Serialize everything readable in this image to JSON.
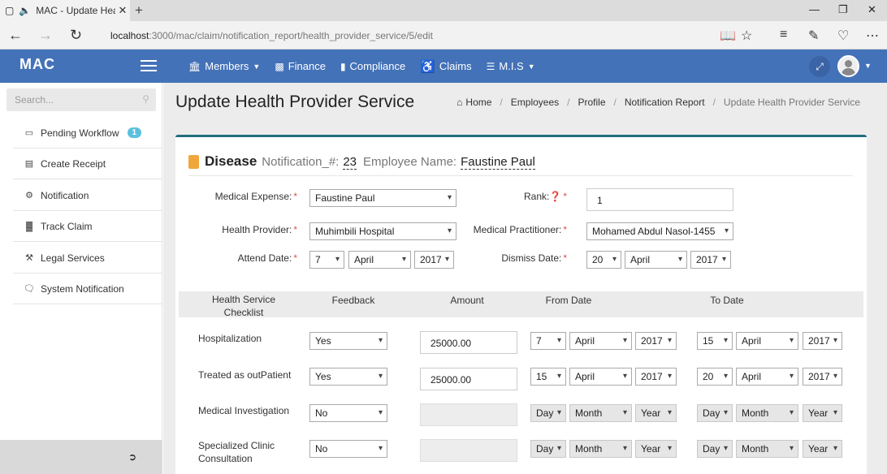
{
  "browser": {
    "tab_title": "MAC - Update Heal",
    "url_host": "localhost",
    "url_path": ":3000/mac/claim/notification_report/health_provider_service/5/edit"
  },
  "header": {
    "logo": "MAC",
    "menu": [
      {
        "label": "Members",
        "icon": "bank-icon",
        "has_caret": true
      },
      {
        "label": "Finance",
        "icon": "money-icon",
        "has_caret": false
      },
      {
        "label": "Compliance",
        "icon": "book-icon",
        "has_caret": false
      },
      {
        "label": "Claims",
        "icon": "wheelchair-icon",
        "has_caret": false
      },
      {
        "label": "M.I.S",
        "icon": "list-icon",
        "has_caret": true
      }
    ]
  },
  "sidebar": {
    "search_placeholder": "Search...",
    "items": [
      {
        "label": "Pending Workflow",
        "icon": "inbox-icon",
        "badge": "1"
      },
      {
        "label": "Create Receipt",
        "icon": "receipt-icon"
      },
      {
        "label": "Notification",
        "icon": "gear-icon"
      },
      {
        "label": "Track Claim",
        "icon": "chart-icon"
      },
      {
        "label": "Legal Services",
        "icon": "gavel-icon"
      },
      {
        "label": "System Notification",
        "icon": "comment-icon"
      }
    ]
  },
  "page": {
    "title": "Update Health Provider Service",
    "breadcrumb": [
      "Home",
      "Employees",
      "Profile",
      "Notification Report",
      "Update Health Provider Service"
    ]
  },
  "card": {
    "heading": "Disease",
    "notification_label": "Notification_#:",
    "notification_number": "23",
    "employee_label": "Employee Name:",
    "employee_name": "Faustine Paul"
  },
  "form": {
    "medical_expense": {
      "label": "Medical Expense:",
      "value": "Faustine Paul"
    },
    "rank": {
      "label": "Rank:",
      "value": "1"
    },
    "health_provider": {
      "label": "Health Provider:",
      "value": "Muhimbili Hospital"
    },
    "medical_practitioner": {
      "label": "Medical Practitioner:",
      "value": "Mohamed Abdul Nasol-1455"
    },
    "attend_date": {
      "label": "Attend Date:",
      "day": "7",
      "month": "April",
      "year": "2017"
    },
    "dismiss_date": {
      "label": "Dismiss Date:",
      "day": "20",
      "month": "April",
      "year": "2017"
    }
  },
  "table": {
    "headers": [
      "Health Service Checklist",
      "Feedback",
      "Amount",
      "From Date",
      "To Date"
    ],
    "rows": [
      {
        "service": "Hospitalization",
        "feedback": "Yes",
        "amount": "25000.00",
        "from": {
          "day": "7",
          "month": "April",
          "year": "2017"
        },
        "to": {
          "day": "15",
          "month": "April",
          "year": "2017"
        }
      },
      {
        "service": "Treated as outPatient",
        "feedback": "Yes",
        "amount": "25000.00",
        "from": {
          "day": "15",
          "month": "April",
          "year": "2017"
        },
        "to": {
          "day": "20",
          "month": "April",
          "year": "2017"
        }
      },
      {
        "service": "Medical Investigation",
        "feedback": "No",
        "amount": "",
        "from": {
          "day": "Day",
          "month": "Month",
          "year": "Year"
        },
        "to": {
          "day": "Day",
          "month": "Month",
          "year": "Year"
        }
      },
      {
        "service": "Specialized Clinic Consultation",
        "feedback": "No",
        "amount": "",
        "from": {
          "day": "Day",
          "month": "Month",
          "year": "Year"
        },
        "to": {
          "day": "Day",
          "month": "Month",
          "year": "Year"
        }
      }
    ]
  }
}
